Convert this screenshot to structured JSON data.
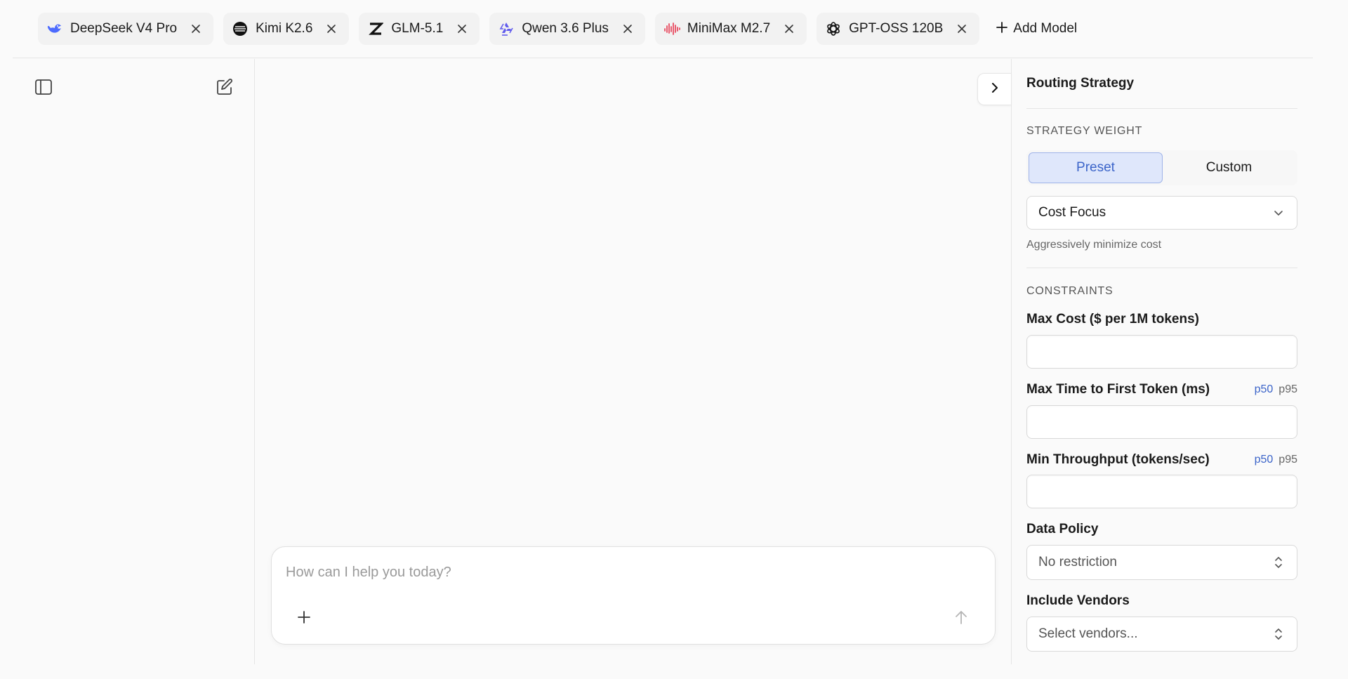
{
  "tabs": [
    {
      "label": "DeepSeek V4 Pro",
      "logo": "deepseek-logo-icon"
    },
    {
      "label": "Kimi K2.6",
      "logo": "kimi-logo-icon"
    },
    {
      "label": "GLM-5.1",
      "logo": "zhipu-logo-icon"
    },
    {
      "label": "Qwen 3.6 Plus",
      "logo": "qwen-logo-icon"
    },
    {
      "label": "MiniMax M2.7",
      "logo": "minimax-logo-icon"
    },
    {
      "label": "GPT-OSS 120B",
      "logo": "openai-logo-icon"
    }
  ],
  "add_model_label": "Add Model",
  "composer": {
    "placeholder": "How can I help you today?"
  },
  "panel": {
    "title": "Routing Strategy",
    "strategy_weight": {
      "section_label": "STRATEGY WEIGHT",
      "options": [
        "Preset",
        "Custom"
      ],
      "selected": "Preset",
      "preset_value": "Cost Focus",
      "preset_hint": "Aggressively minimize cost"
    },
    "constraints": {
      "section_label": "CONSTRAINTS",
      "max_cost_label": "Max Cost ($ per 1M tokens)",
      "max_cost_value": "",
      "ttft_label": "Max Time to First Token (ms)",
      "ttft_value": "",
      "ttft_percentiles": [
        "p50",
        "p95"
      ],
      "ttft_selected": "p50",
      "throughput_label": "Min Throughput (tokens/sec)",
      "throughput_value": "",
      "throughput_percentiles": [
        "p50",
        "p95"
      ],
      "throughput_selected": "p50",
      "data_policy_label": "Data Policy",
      "data_policy_value": "No restriction",
      "vendors_label": "Include Vendors",
      "vendors_placeholder": "Select vendors..."
    }
  },
  "colors": {
    "accent": "#3b64c9",
    "accent_bg": "#dfe7fb",
    "border": "#e5e5e5",
    "background": "#fafafa"
  }
}
